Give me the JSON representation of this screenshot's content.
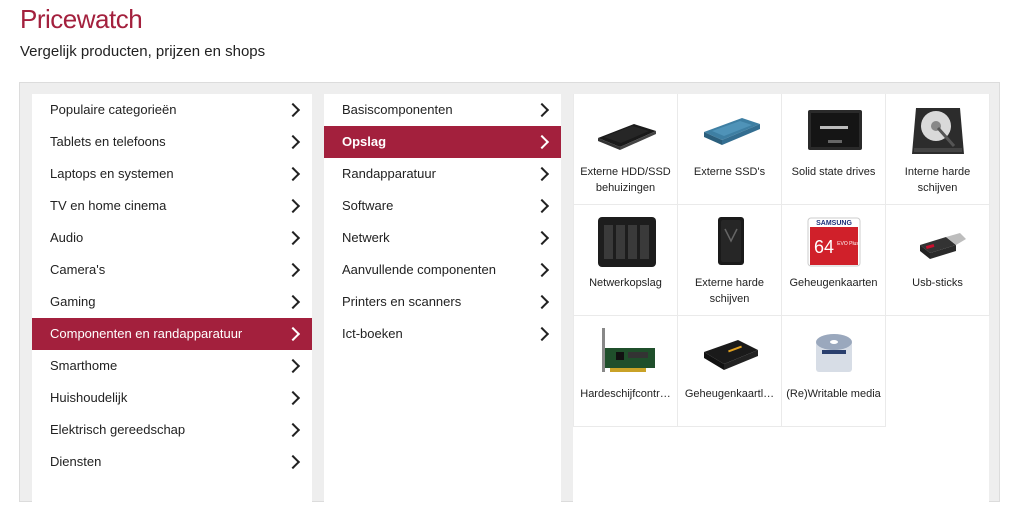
{
  "header": {
    "title": "Pricewatch",
    "subtitle": "Vergelijk producten, prijzen en shops"
  },
  "categories": [
    {
      "label": "Populaire categorieën",
      "active": false
    },
    {
      "label": "Tablets en telefoons",
      "active": false
    },
    {
      "label": "Laptops en systemen",
      "active": false
    },
    {
      "label": "TV en home cinema",
      "active": false
    },
    {
      "label": "Audio",
      "active": false
    },
    {
      "label": "Camera's",
      "active": false
    },
    {
      "label": "Gaming",
      "active": false
    },
    {
      "label": "Componenten en randapparatuur",
      "active": true
    },
    {
      "label": "Smarthome",
      "active": false
    },
    {
      "label": "Huishoudelijk",
      "active": false
    },
    {
      "label": "Elektrisch gereedschap",
      "active": false
    },
    {
      "label": "Diensten",
      "active": false
    }
  ],
  "subcategories": [
    {
      "label": "Basiscomponenten",
      "active": false
    },
    {
      "label": "Opslag",
      "active": true
    },
    {
      "label": "Randapparatuur",
      "active": false
    },
    {
      "label": "Software",
      "active": false
    },
    {
      "label": "Netwerk",
      "active": false
    },
    {
      "label": "Aanvullende componenten",
      "active": false
    },
    {
      "label": "Printers en scanners",
      "active": false
    },
    {
      "label": "Ict-boeken",
      "active": false
    }
  ],
  "products": [
    {
      "label": "Externe HDD/SSD behuizingen",
      "icon": "hdd-enclosure-icon"
    },
    {
      "label": "Externe SSD's",
      "icon": "external-ssd-icon"
    },
    {
      "label": "Solid state drives",
      "icon": "ssd-icon"
    },
    {
      "label": "Interne harde schijven",
      "icon": "internal-hdd-icon"
    },
    {
      "label": "Netwerkopslag",
      "icon": "nas-icon"
    },
    {
      "label": "Externe harde schijven",
      "icon": "external-hdd-icon"
    },
    {
      "label": "Geheugenkaarten",
      "icon": "memory-card-icon",
      "card_text": {
        "brand": "SAMSUNG",
        "capacity": "64",
        "model": "EVO Plus"
      }
    },
    {
      "label": "Usb-sticks",
      "icon": "usb-stick-icon"
    },
    {
      "label": "Hardeschijfcontr…",
      "icon": "disk-controller-icon"
    },
    {
      "label": "Geheugenkaartl…",
      "icon": "card-reader-icon"
    },
    {
      "label": "(Re)Writable media",
      "icon": "disc-media-icon"
    }
  ],
  "colors": {
    "accent": "#a3203d"
  }
}
